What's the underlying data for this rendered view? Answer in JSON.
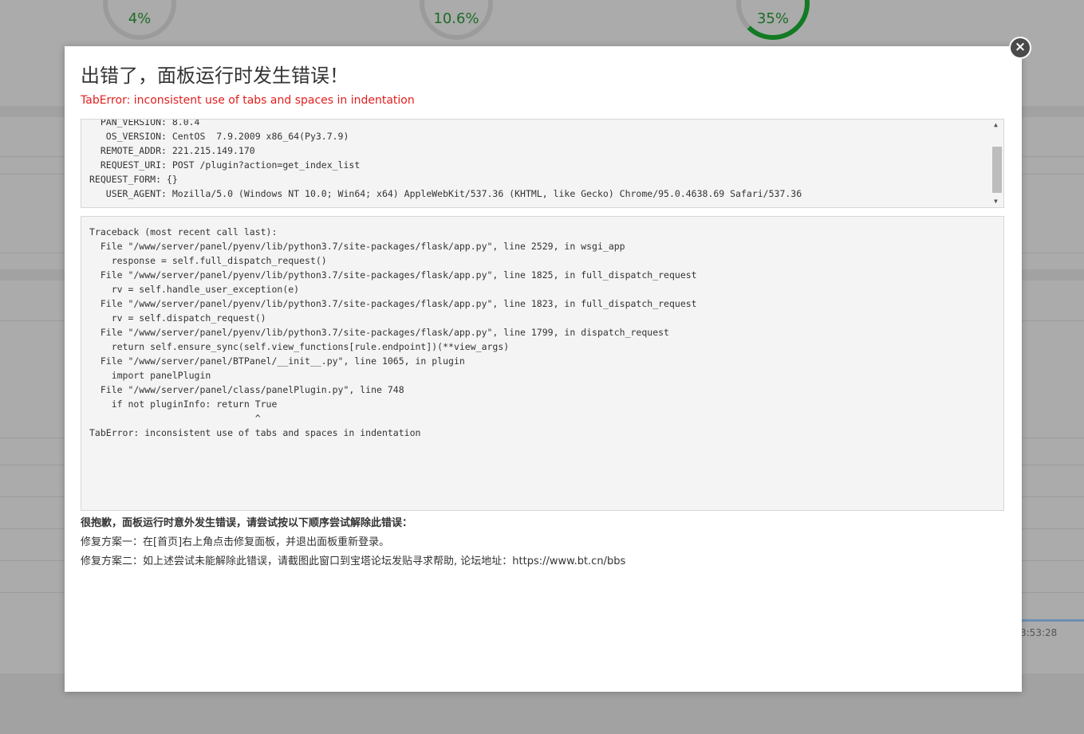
{
  "background": {
    "gauges": [
      {
        "value": "4%"
      },
      {
        "value": "10.6%"
      },
      {
        "value": "35%"
      }
    ],
    "chart_time": "3:53:28",
    "accent_color": "#137a24"
  },
  "dialog": {
    "title": "出错了，面板运行时发生错误！",
    "error_summary": "TabError: inconsistent use of tabs and spaces in indentation",
    "error_color": "#e0201e",
    "close_label": "×",
    "env_info": [
      "  PAN_VERSION: 8.0.4",
      "   OS_VERSION: CentOS  7.9.2009 x86_64(Py3.7.9)",
      "  REMOTE_ADDR: 221.215.149.170",
      "  REQUEST_URI: POST /plugin?action=get_index_list",
      "REQUEST_FORM: {}",
      "   USER_AGENT: Mozilla/5.0 (Windows NT 10.0; Win64; x64) AppleWebKit/537.36 (KHTML, like Gecko) Chrome/95.0.4638.69 Safari/537.36"
    ],
    "traceback": [
      "Traceback (most recent call last):",
      "  File \"/www/server/panel/pyenv/lib/python3.7/site-packages/flask/app.py\", line 2529, in wsgi_app",
      "    response = self.full_dispatch_request()",
      "  File \"/www/server/panel/pyenv/lib/python3.7/site-packages/flask/app.py\", line 1825, in full_dispatch_request",
      "    rv = self.handle_user_exception(e)",
      "  File \"/www/server/panel/pyenv/lib/python3.7/site-packages/flask/app.py\", line 1823, in full_dispatch_request",
      "    rv = self.dispatch_request()",
      "  File \"/www/server/panel/pyenv/lib/python3.7/site-packages/flask/app.py\", line 1799, in dispatch_request",
      "    return self.ensure_sync(self.view_functions[rule.endpoint])(**view_args)",
      "  File \"/www/server/panel/BTPanel/__init__.py\", line 1065, in plugin",
      "    import panelPlugin",
      "  File \"/www/server/panel/class/panelPlugin.py\", line 748",
      "    if not pluginInfo: return True",
      "                              ^",
      "TabError: inconsistent use of tabs and spaces in indentation"
    ],
    "help_title": "很抱歉，面板运行时意外发生错误，请尝试按以下顺序尝试解除此错误：",
    "help_option_1": "修复方案一：在[首页]右上角点击修复面板，并退出面板重新登录。",
    "help_option_2_prefix": "修复方案二：如上述尝试未能解除此错误，请截图此窗口到宝塔论坛发贴寻求帮助, 论坛地址：",
    "help_option_2_link": "https://www.bt.cn/bbs"
  }
}
